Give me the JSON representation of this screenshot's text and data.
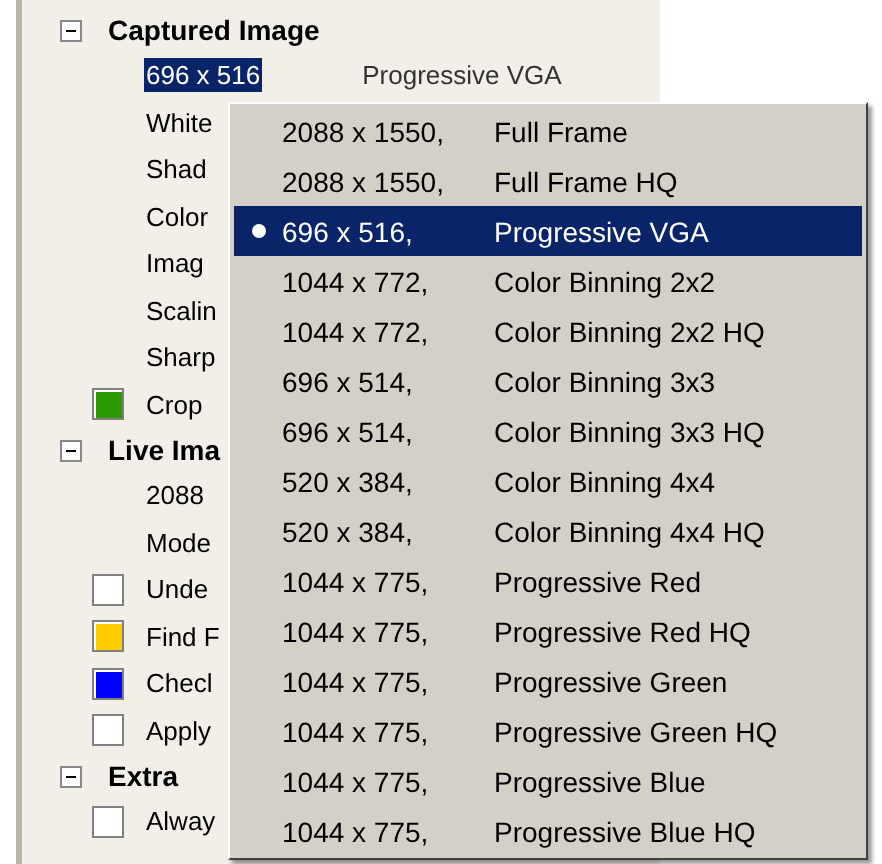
{
  "sections": [
    {
      "title": "Captured Image",
      "expanded": true,
      "rows": [
        {
          "kind": "text",
          "label": "696 x 516",
          "selected": true,
          "value": "Progressive VGA"
        },
        {
          "kind": "text",
          "label": "White",
          "selected": false
        },
        {
          "kind": "text",
          "label": "Shad",
          "selected": false
        },
        {
          "kind": "text",
          "label": "Color",
          "selected": false
        },
        {
          "kind": "text",
          "label": "Imag",
          "selected": false
        },
        {
          "kind": "text",
          "label": "Scalin",
          "selected": false
        },
        {
          "kind": "text",
          "label": "Sharp",
          "selected": false
        },
        {
          "kind": "swatch",
          "label": "Crop",
          "selected": false,
          "color": "#2a9a00"
        }
      ]
    },
    {
      "title": "Live Ima",
      "expanded": true,
      "rows": [
        {
          "kind": "text",
          "label": "2088",
          "selected": false
        },
        {
          "kind": "text",
          "label": "Mode",
          "selected": false
        },
        {
          "kind": "swatch",
          "label": "Unde",
          "selected": false,
          "color": "#ffffff"
        },
        {
          "kind": "swatch",
          "label": "Find F",
          "selected": false,
          "color": "#ffcc00"
        },
        {
          "kind": "swatch",
          "label": "Checl",
          "selected": false,
          "color": "#0000ff"
        },
        {
          "kind": "swatch",
          "label": "Apply",
          "selected": false,
          "color": "#ffffff"
        }
      ]
    },
    {
      "title": "Extra",
      "expanded": true,
      "rows": [
        {
          "kind": "swatch",
          "label": "Alway",
          "selected": false,
          "color": "#ffffff"
        }
      ]
    }
  ],
  "menu": {
    "items": [
      {
        "size": "2088 x 1550,",
        "mode": "Full Frame",
        "selected": false
      },
      {
        "size": "2088 x 1550,",
        "mode": "Full Frame HQ",
        "selected": false
      },
      {
        "size": "696 x 516,",
        "mode": "Progressive VGA",
        "selected": true
      },
      {
        "size": "1044 x 772,",
        "mode": "Color Binning 2x2",
        "selected": false
      },
      {
        "size": "1044 x 772,",
        "mode": "Color Binning 2x2 HQ",
        "selected": false
      },
      {
        "size": "696 x 514,",
        "mode": "Color Binning 3x3",
        "selected": false
      },
      {
        "size": "696 x 514,",
        "mode": "Color Binning 3x3 HQ",
        "selected": false
      },
      {
        "size": "520 x 384,",
        "mode": "Color Binning 4x4",
        "selected": false
      },
      {
        "size": "520 x 384,",
        "mode": "Color Binning 4x4 HQ",
        "selected": false
      },
      {
        "size": "1044 x 775,",
        "mode": "Progressive Red",
        "selected": false
      },
      {
        "size": "1044 x 775,",
        "mode": "Progressive Red HQ",
        "selected": false
      },
      {
        "size": "1044 x 775,",
        "mode": "Progressive Green",
        "selected": false
      },
      {
        "size": "1044 x 775,",
        "mode": "Progressive Green HQ",
        "selected": false
      },
      {
        "size": "1044 x 775,",
        "mode": "Progressive Blue",
        "selected": false
      },
      {
        "size": "1044 x 775,",
        "mode": "Progressive Blue HQ",
        "selected": false
      }
    ]
  }
}
